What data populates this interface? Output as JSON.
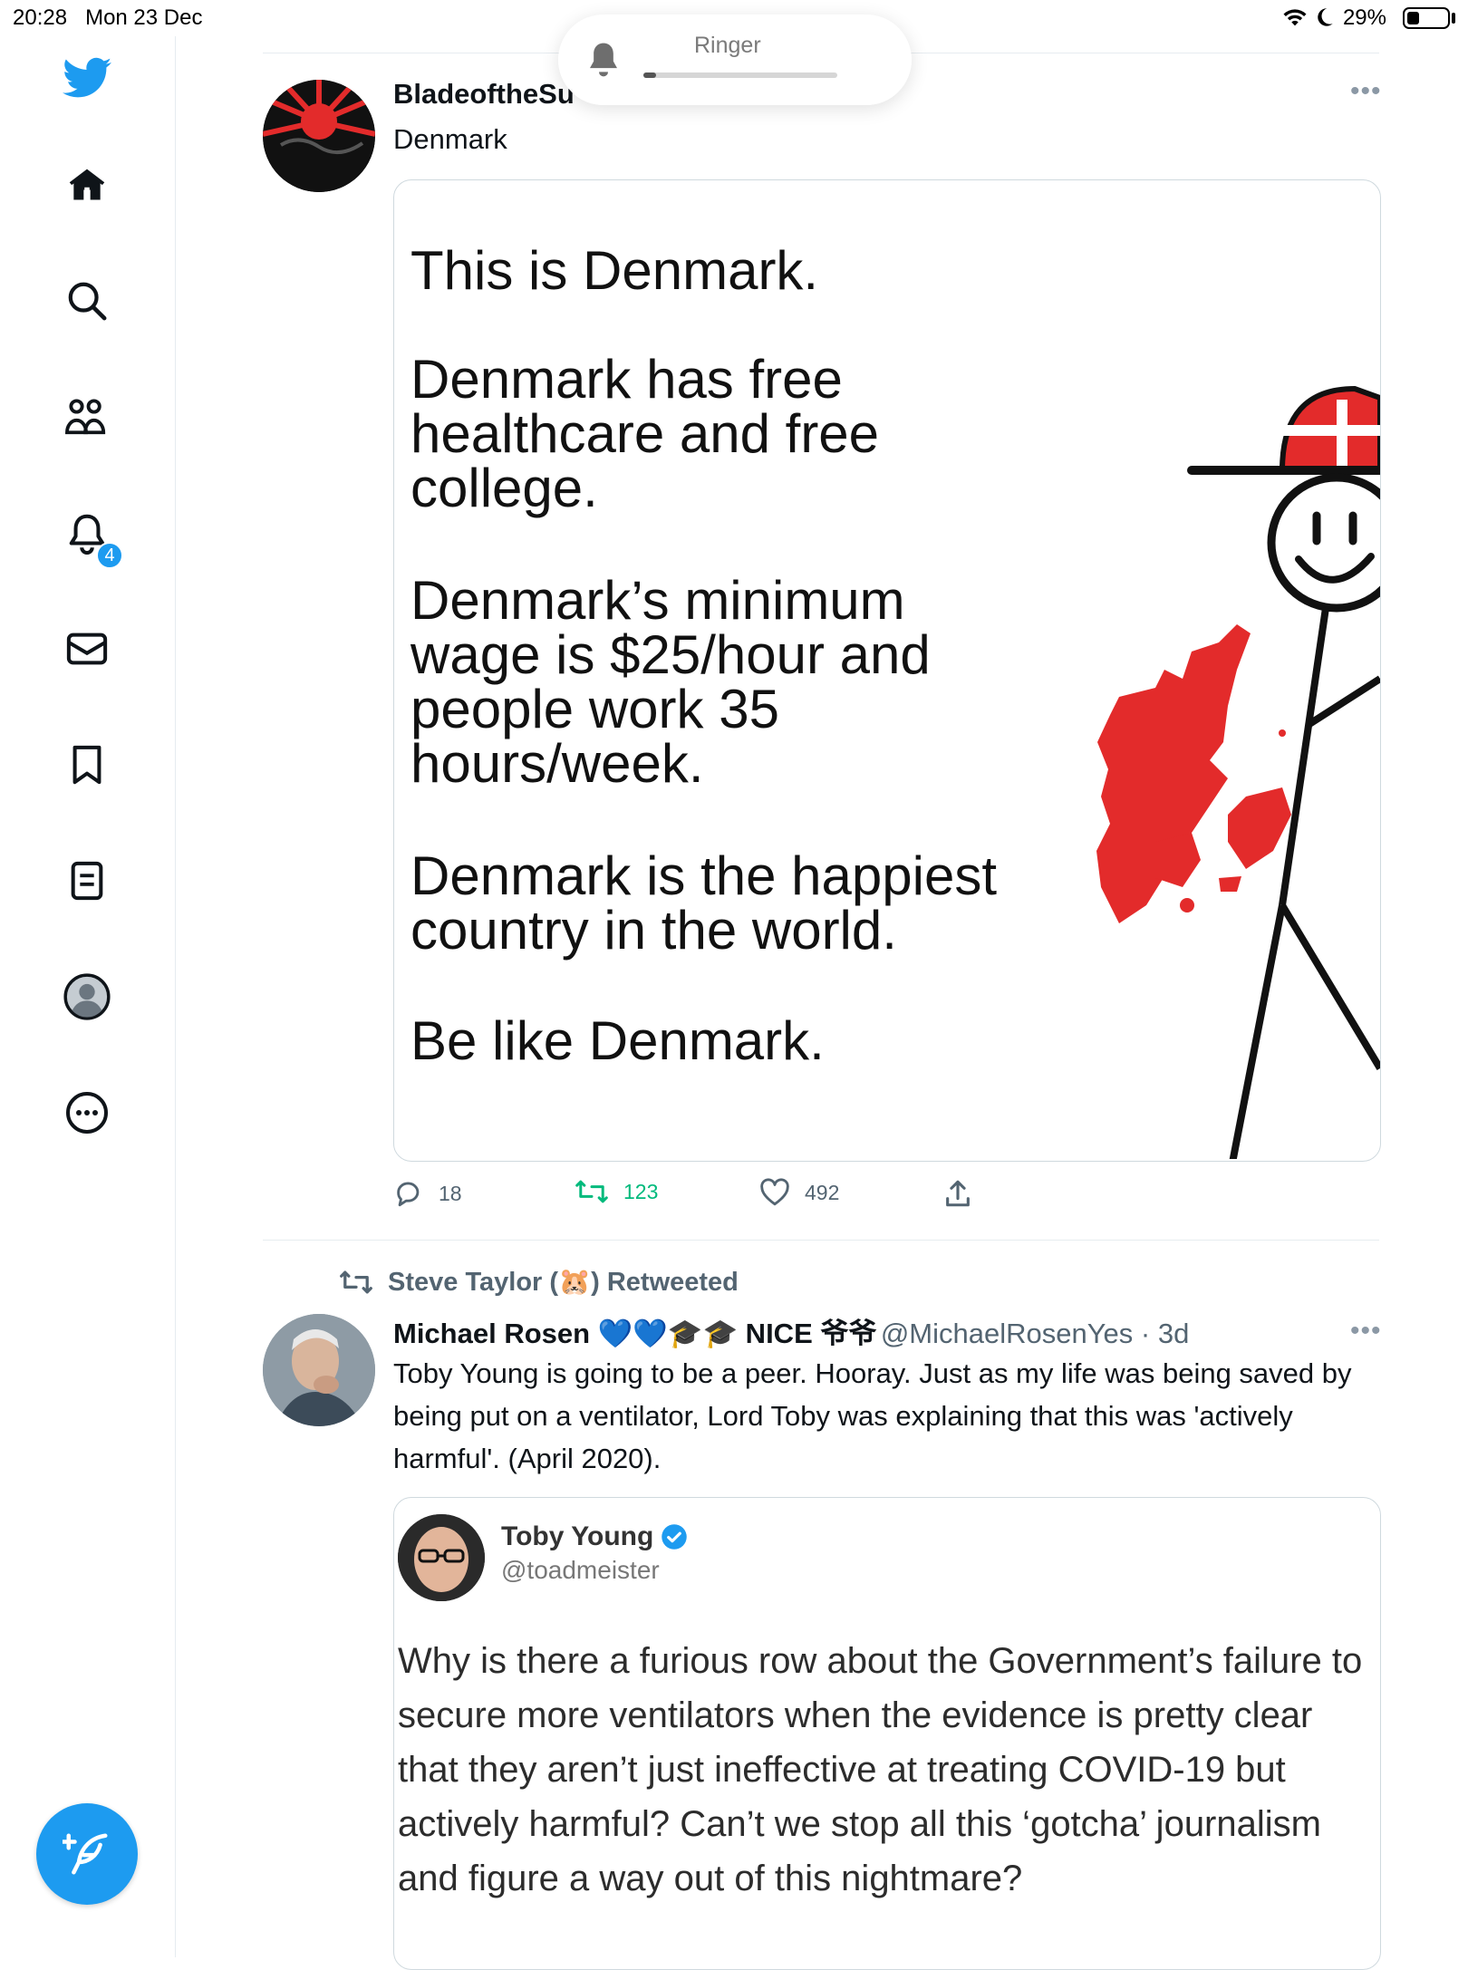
{
  "status_bar": {
    "time": "20:28",
    "date": "Mon 23 Dec",
    "battery_percent": "29%",
    "battery_level": 0.29,
    "icons": [
      "wifi-icon",
      "moon-icon",
      "battery-icon"
    ]
  },
  "ringer_hud": {
    "label": "Ringer",
    "icon": "bell-icon",
    "volume_level": 0.05
  },
  "sidebar": {
    "items": [
      {
        "icon": "twitter-logo-icon"
      },
      {
        "icon": "home-icon"
      },
      {
        "icon": "search-icon"
      },
      {
        "icon": "communities-icon"
      },
      {
        "icon": "notifications-bell-icon",
        "badge": "4"
      },
      {
        "icon": "messages-mail-icon"
      },
      {
        "icon": "bookmark-icon"
      },
      {
        "icon": "lists-icon"
      },
      {
        "icon": "profile-avatar-icon"
      },
      {
        "icon": "more-circle-icon"
      }
    ],
    "compose_icon": "compose-feather-icon"
  },
  "tweet1": {
    "display_name": "BladeoftheSu",
    "text": "Denmark",
    "meme": {
      "lines": [
        "This is Denmark.",
        "Denmark has free",
        "healthcare and free",
        "college.",
        "Denmark’s minimum",
        "wage is $25/hour and",
        "people work 35",
        "hours/week.",
        "Denmark is the happiest",
        "country in the world.",
        "Be like Denmark."
      ]
    },
    "actions": {
      "reply_count": "18",
      "retweet_count": "123",
      "like_count": "492"
    }
  },
  "tweet2": {
    "retweeted_by": "Steve Taylor (🐹) Retweeted",
    "display_name": "Michael Rosen 💙💙🎓🎓 NICE 爷爷",
    "handle_time": "@MichaelRosenYes · 3d",
    "text": "Toby Young is going to be a peer. Hooray. Just as my life was being saved by being put on a ventilator, Lord Toby was explaining that this was 'actively harmful'.  (April 2020).",
    "quoted": {
      "name": "Toby Young",
      "handle": "@toadmeister",
      "text": "Why is there a furious row about the Government’s failure to secure more ventilators when the evidence is pretty clear that they aren’t just ineffective at treating COVID-19 but actively harmful? Can’t we stop all this ‘gotcha’ journalism and figure a way out of this nightmare?"
    }
  },
  "colors": {
    "twitter_blue": "#1d9bf0",
    "retweet_green": "#00ba7c",
    "danish_red": "#e32b2b",
    "muted_text": "#536471"
  }
}
